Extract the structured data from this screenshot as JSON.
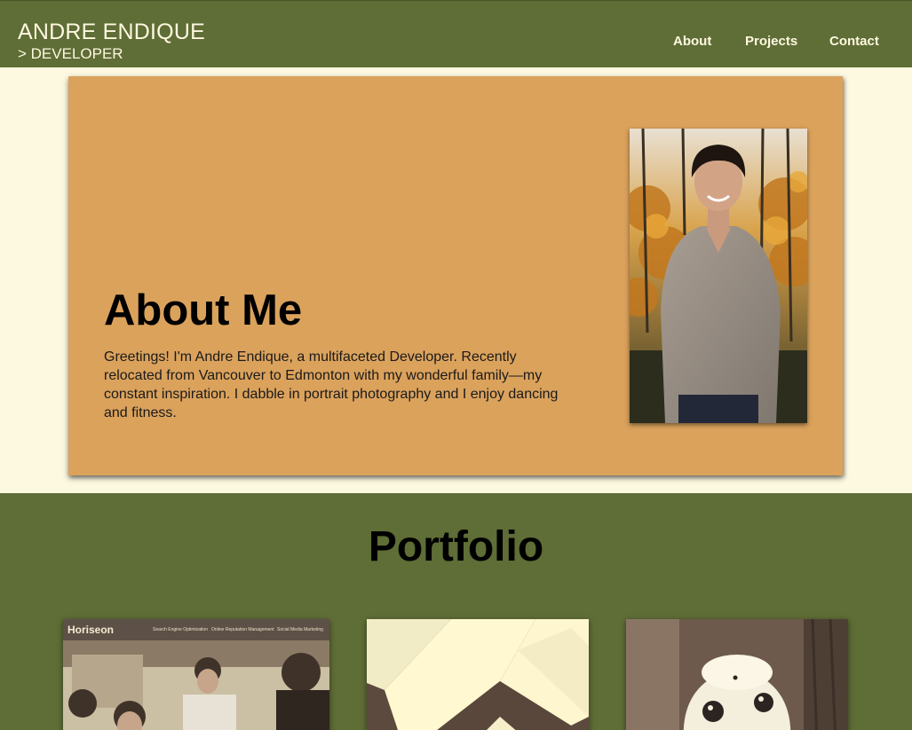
{
  "header": {
    "name": "ANDRE ENDIQUE",
    "role": "> DEVELOPER",
    "nav": [
      "About",
      "Projects",
      "Contact"
    ]
  },
  "about": {
    "title": "About Me",
    "text": "Greetings! I'm Andre Endique, a multifaceted Developer. Recently relocated from Vancouver to Edmonton with my wonderful family—my constant inspiration. I dabble in portrait photography and I enjoy dancing and fitness."
  },
  "portfolio": {
    "title": "Portfolio",
    "projects": [
      {
        "brand": "Horiseon",
        "links": [
          "Search Engine Optimization",
          "Online Reputation Management",
          "Social Media Marketing"
        ]
      },
      {},
      {}
    ]
  },
  "colors": {
    "olive": "#5f6d36",
    "cream": "#fdf8e0",
    "tan": "#dba25c"
  }
}
